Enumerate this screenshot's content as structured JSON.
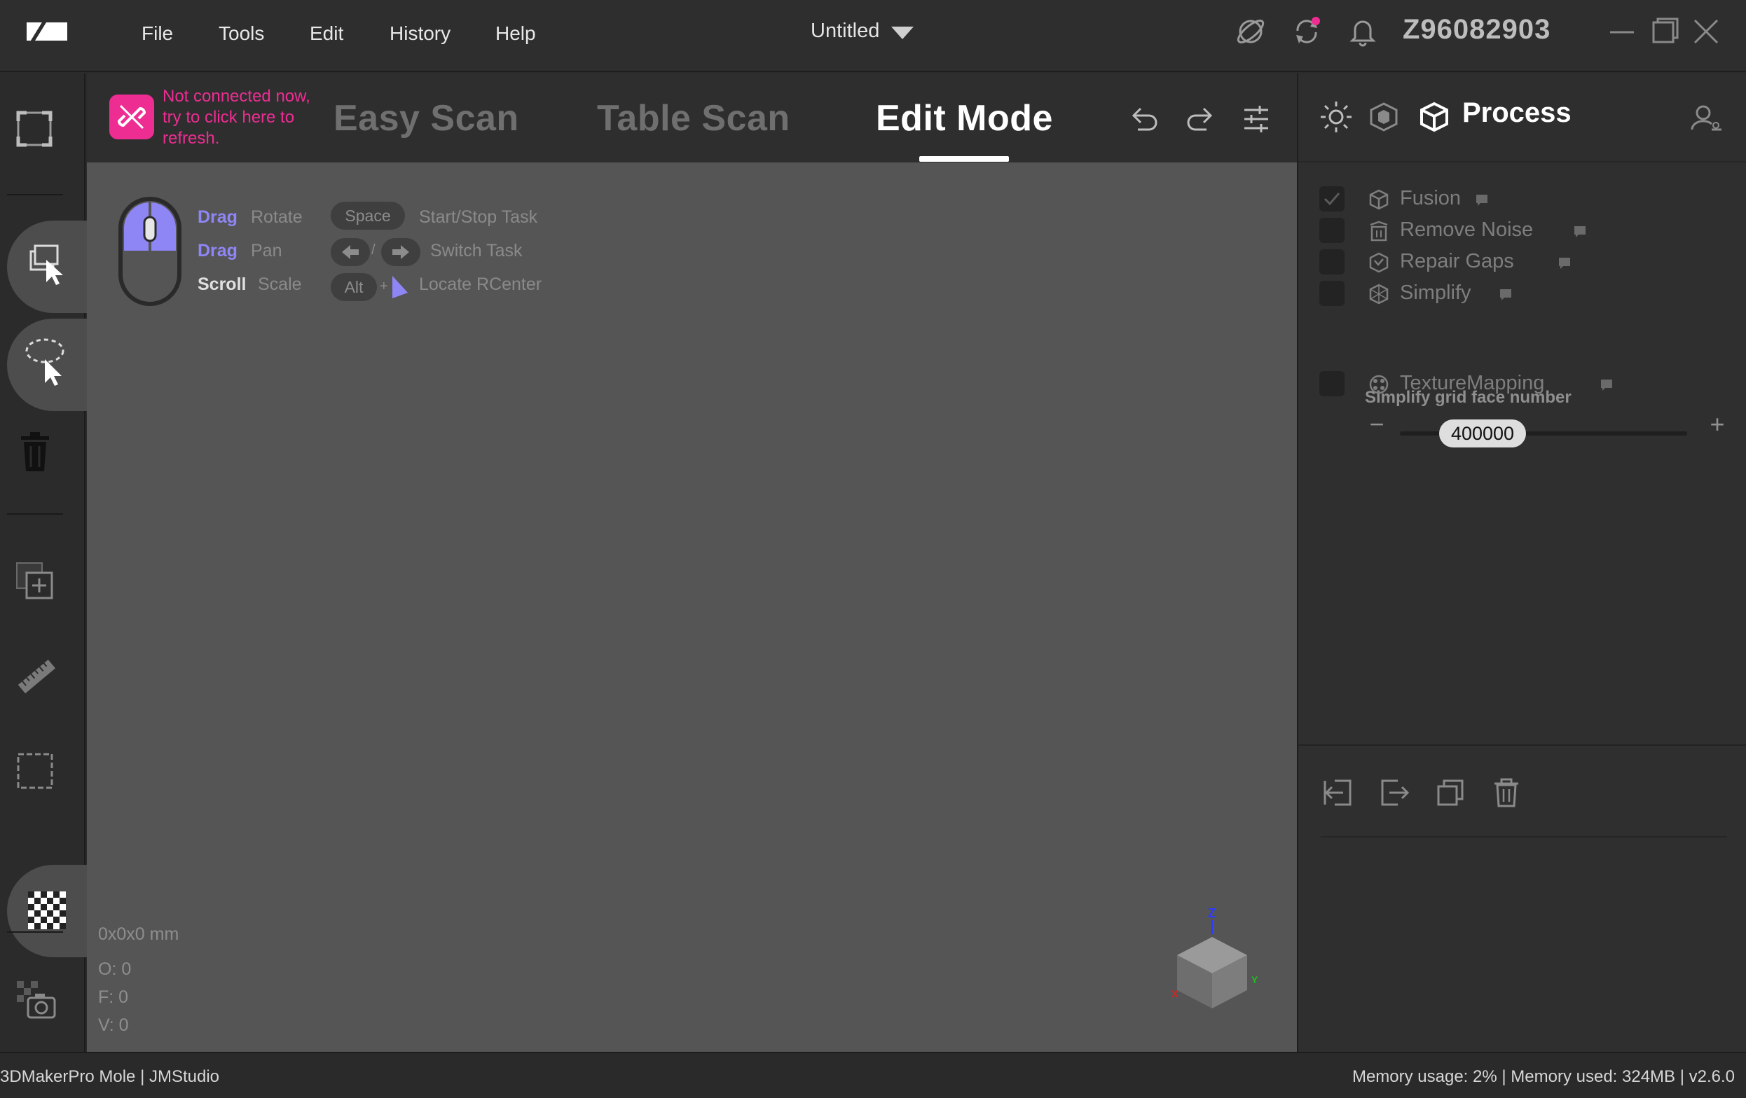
{
  "menu": {
    "file": "File",
    "tools": "Tools",
    "edit": "Edit",
    "history": "History",
    "help": "Help"
  },
  "document": {
    "title": "Untitled"
  },
  "titlebar": {
    "user_id": "Z96082903",
    "icons": [
      "satellite-icon",
      "sync-icon",
      "bell-icon",
      "minimize-icon",
      "maximize-icon",
      "close-icon"
    ],
    "notification_dot_color": "#ee2d93"
  },
  "connection": {
    "message": "Not connected now, try to click here to refresh.",
    "color": "#ee2d93"
  },
  "mode_tabs": {
    "easy_scan": "Easy Scan",
    "table_scan": "Table Scan",
    "edit_mode": "Edit Mode",
    "active": "Edit Mode"
  },
  "hints": {
    "drag1": "Drag",
    "rotate": "Rotate",
    "drag2": "Drag",
    "pan": "Pan",
    "scroll": "Scroll",
    "scale": "Scale",
    "space_key": "Space",
    "start_stop": "Start/Stop Task",
    "slash": "/",
    "switch_task": "Switch Task",
    "alt_key": "Alt",
    "plus": "+",
    "locate": "Locate RCenter",
    "accent_color": "#8f86f6"
  },
  "viewport": {
    "dimensions": "0x0x0 mm",
    "o": "O: 0",
    "f": "F: 0",
    "v": "V: 0",
    "background": "#555555"
  },
  "process_panel": {
    "title": "Process",
    "steps": [
      {
        "label": "Fusion",
        "checked": true
      },
      {
        "label": "Remove Noise",
        "checked": false
      },
      {
        "label": "Repair Gaps",
        "checked": false
      },
      {
        "label": "Simplify",
        "checked": false
      },
      {
        "label": "TextureMapping",
        "checked": false
      }
    ],
    "simplify": {
      "label": "Simplify grid face number",
      "value": "400000",
      "minus": "−",
      "plus": "+"
    }
  },
  "statusbar": {
    "left": "3DMakerPro Mole  |  JMStudio",
    "right": "Memory usage: 2% | Memory used: 324MB | v2.6.0"
  }
}
